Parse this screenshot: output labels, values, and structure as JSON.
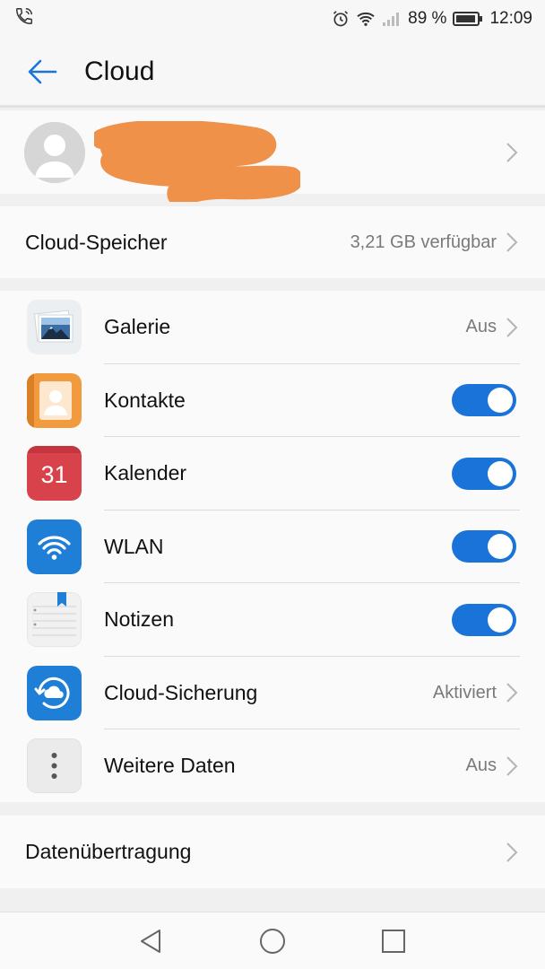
{
  "status": {
    "battery_percent": "89 %",
    "time": "12:09"
  },
  "header": {
    "title": "Cloud"
  },
  "storage": {
    "label": "Cloud-Speicher",
    "value": "3,21 GB verfügbar"
  },
  "apps": [
    {
      "label": "Galerie",
      "value": "Aus",
      "icon": "gallery-icon"
    },
    {
      "label": "Kontakte",
      "toggle": true,
      "icon": "contacts-icon"
    },
    {
      "label": "Kalender",
      "toggle": true,
      "icon": "calendar-icon",
      "icon_text": "31"
    },
    {
      "label": "WLAN",
      "toggle": true,
      "icon": "wifi-icon"
    },
    {
      "label": "Notizen",
      "toggle": true,
      "icon": "notes-icon"
    },
    {
      "label": "Cloud-Sicherung",
      "value": "Aktiviert",
      "icon": "cloud-backup-icon"
    },
    {
      "label": "Weitere Daten",
      "value": "Aus",
      "icon": "more-data-icon"
    }
  ],
  "transfer": {
    "label": "Datenübertragung"
  },
  "colors": {
    "accent": "#1a73d8",
    "redaction": "#f0914a"
  }
}
